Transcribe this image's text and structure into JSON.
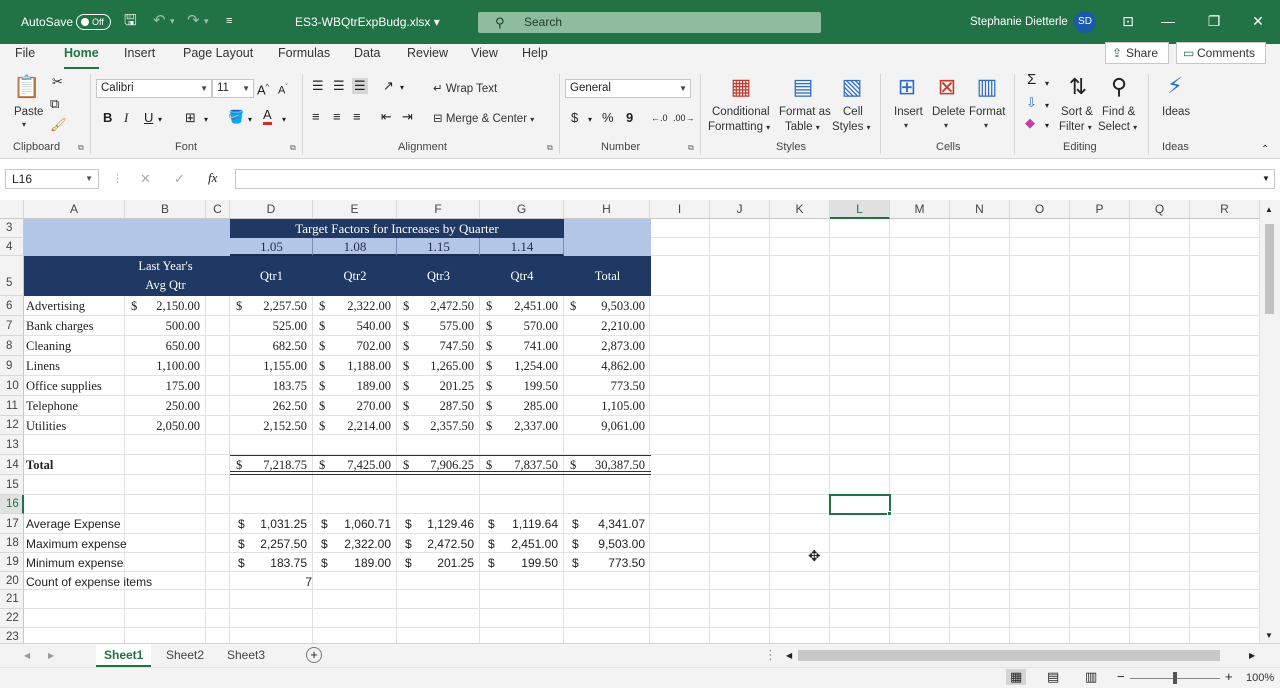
{
  "titlebar": {
    "autosave_label": "AutoSave",
    "autosave_state": "Off",
    "file_name": "ES3-WBQtrExpBudg.xlsx",
    "search_placeholder": "Search",
    "user_name": "Stephanie Dietterle",
    "user_initials": "SD"
  },
  "ribbon_tabs": [
    "File",
    "Home",
    "Insert",
    "Page Layout",
    "Formulas",
    "Data",
    "Review",
    "View",
    "Help"
  ],
  "share_label": "Share",
  "comments_label": "Comments",
  "ribbon": {
    "clipboard": {
      "label": "Clipboard",
      "paste": "Paste"
    },
    "font": {
      "label": "Font",
      "name": "Calibri",
      "size": "11",
      "bold": "B",
      "italic": "I",
      "underline": "U"
    },
    "alignment": {
      "label": "Alignment",
      "wrap": "Wrap Text",
      "merge": "Merge & Center"
    },
    "number": {
      "label": "Number",
      "format": "General",
      "currency": "$",
      "percent": "%",
      "comma": "9"
    },
    "styles": {
      "label": "Styles",
      "conditional_1": "Conditional",
      "conditional_2": "Formatting",
      "format_table_1": "Format as",
      "format_table_2": "Table",
      "cell_styles_1": "Cell",
      "cell_styles_2": "Styles"
    },
    "cells": {
      "label": "Cells",
      "insert": "Insert",
      "delete": "Delete",
      "format": "Format"
    },
    "editing": {
      "label": "Editing",
      "sort_1": "Sort &",
      "sort_2": "Filter",
      "find_1": "Find &",
      "find_2": "Select"
    },
    "ideas": {
      "label": "Ideas",
      "ideas": "Ideas"
    }
  },
  "formula_bar": {
    "name_box": "L16",
    "formula": ""
  },
  "columns": [
    "A",
    "B",
    "C",
    "D",
    "E",
    "F",
    "G",
    "H",
    "I",
    "J",
    "K",
    "L",
    "M",
    "N",
    "O",
    "P",
    "Q",
    "R"
  ],
  "rows": [
    "3",
    "4",
    "5",
    "6",
    "7",
    "8",
    "9",
    "10",
    "11",
    "12",
    "13",
    "14",
    "15",
    "16",
    "17",
    "18",
    "19",
    "20",
    "21",
    "22",
    "23"
  ],
  "sheet": {
    "target_title": "Target Factors for Increases by Quarter",
    "factors": [
      "1.05",
      "1.08",
      "1.15",
      "1.14"
    ],
    "last_year_1": "Last Year's",
    "last_year_2": "Avg Qtr",
    "quarters": [
      "Qtr1",
      "Qtr2",
      "Qtr3",
      "Qtr4"
    ],
    "total_header": "Total",
    "expenses": [
      {
        "name": "Advertising",
        "avg": "2,150.00",
        "q1": "2,257.50",
        "q2": "2,322.00",
        "q3": "2,472.50",
        "q4": "2,451.00",
        "total": "9,503.00"
      },
      {
        "name": "Bank charges",
        "avg": "500.00",
        "q1": "525.00",
        "q2": "540.00",
        "q3": "575.00",
        "q4": "570.00",
        "total": "2,210.00"
      },
      {
        "name": "Cleaning",
        "avg": "650.00",
        "q1": "682.50",
        "q2": "702.00",
        "q3": "747.50",
        "q4": "741.00",
        "total": "2,873.00"
      },
      {
        "name": "Linens",
        "avg": "1,100.00",
        "q1": "1,155.00",
        "q2": "1,188.00",
        "q3": "1,265.00",
        "q4": "1,254.00",
        "total": "4,862.00"
      },
      {
        "name": "Office supplies",
        "avg": "175.00",
        "q1": "183.75",
        "q2": "189.00",
        "q3": "201.25",
        "q4": "199.50",
        "total": "773.50"
      },
      {
        "name": "Telephone",
        "avg": "250.00",
        "q1": "262.50",
        "q2": "270.00",
        "q3": "287.50",
        "q4": "285.00",
        "total": "1,105.00"
      },
      {
        "name": "Utilities",
        "avg": "2,050.00",
        "q1": "2,152.50",
        "q2": "2,214.00",
        "q3": "2,357.50",
        "q4": "2,337.00",
        "total": "9,061.00"
      }
    ],
    "total_label": "Total",
    "totals": {
      "q1": "7,218.75",
      "q2": "7,425.00",
      "q3": "7,906.25",
      "q4": "7,837.50",
      "total": "30,387.50"
    },
    "stats": [
      {
        "label": "Average Expense",
        "q1": "1,031.25",
        "q2": "1,060.71",
        "q3": "1,129.46",
        "q4": "1,119.64",
        "total": "4,341.07"
      },
      {
        "label": "Maximum expense",
        "q1": "2,257.50",
        "q2": "2,322.00",
        "q3": "2,472.50",
        "q4": "2,451.00",
        "total": "9,503.00"
      },
      {
        "label": "Minimum expense",
        "q1": "183.75",
        "q2": "189.00",
        "q3": "201.25",
        "q4": "199.50",
        "total": "773.50"
      }
    ],
    "count_label": "Count of expense items",
    "count_value": "7",
    "currency": "$"
  },
  "sheet_tabs": [
    "Sheet1",
    "Sheet2",
    "Sheet3"
  ],
  "status": {
    "zoom": "100%"
  },
  "colors": {
    "excel_green": "#217346",
    "header_navy": "#203864",
    "header_light": "#b4c6e7"
  }
}
